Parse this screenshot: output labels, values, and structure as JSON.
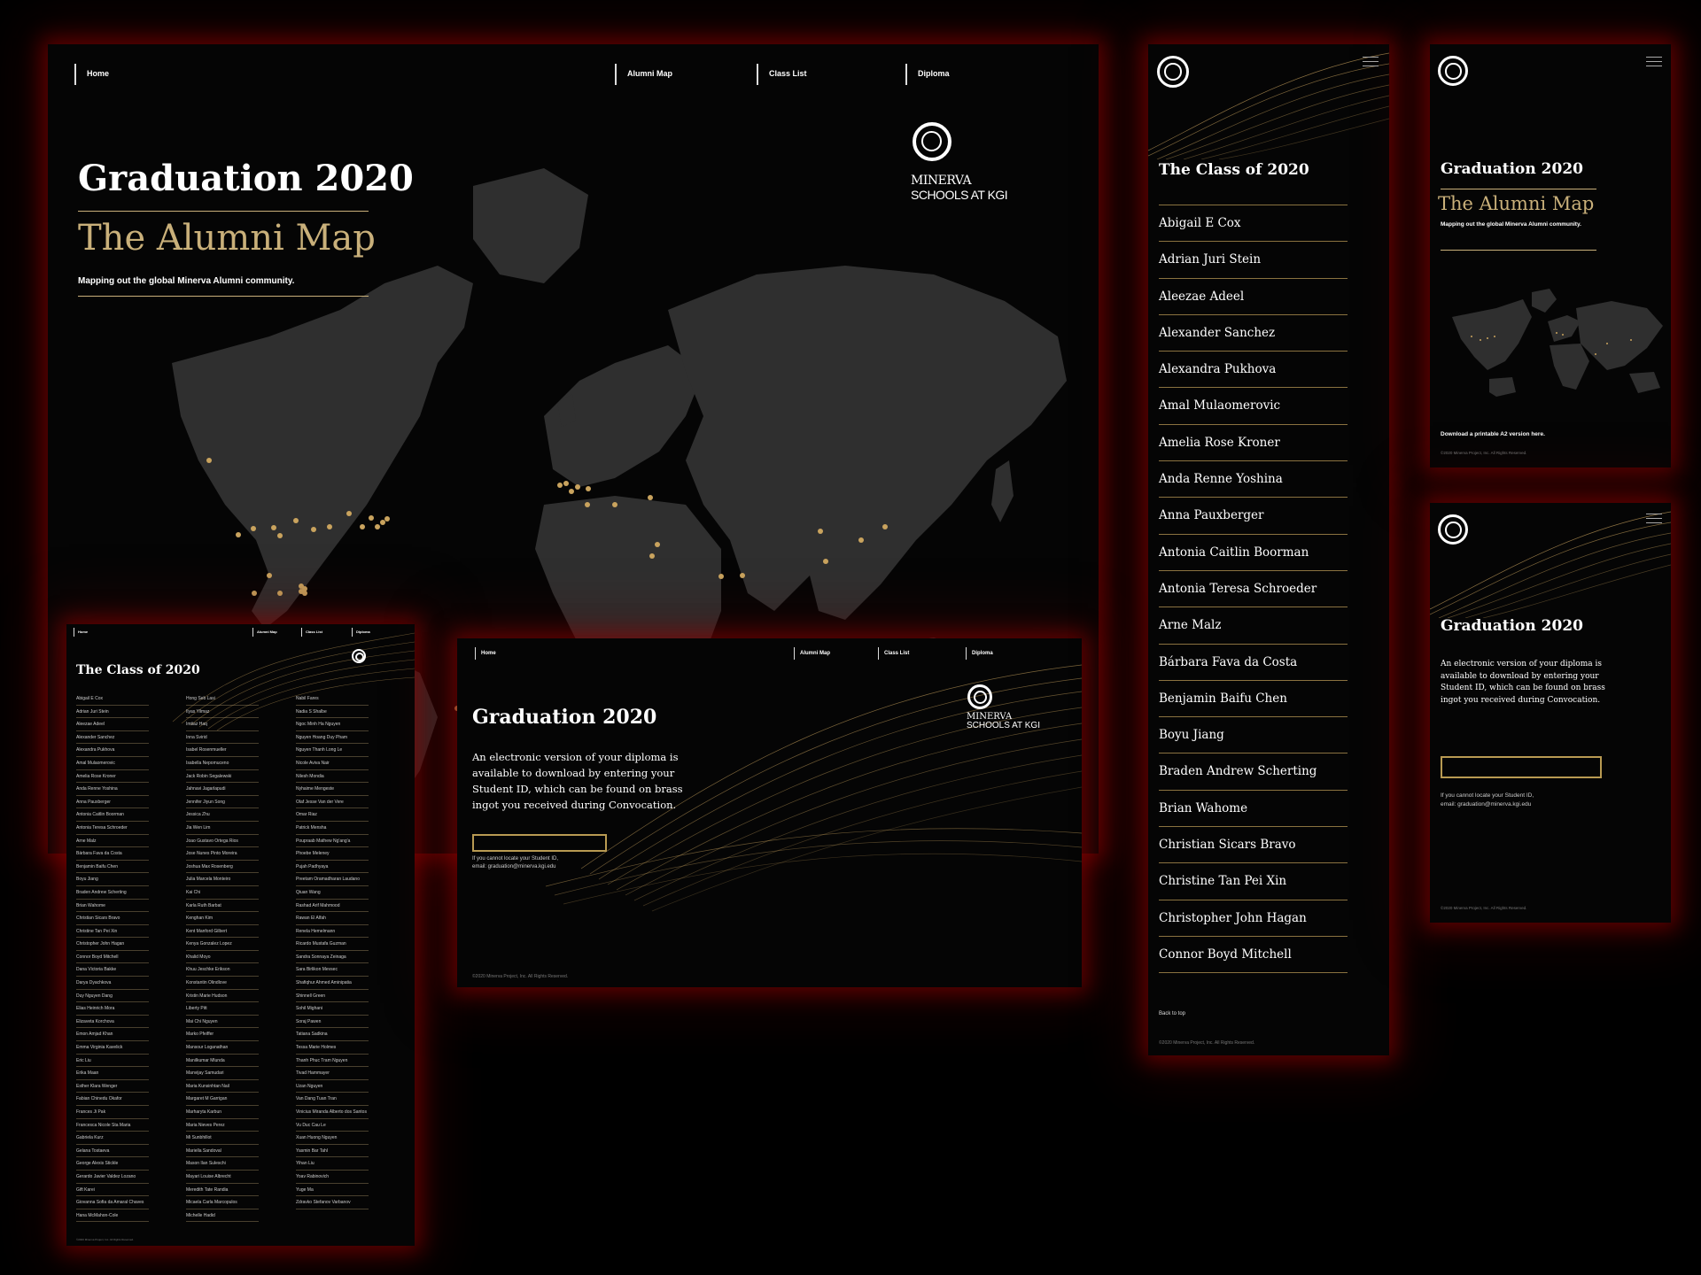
{
  "nav": {
    "home": "Home",
    "alumni_map": "Alumni Map",
    "class_list": "Class List",
    "diploma": "Diploma"
  },
  "brand": {
    "line1": "MINERVA",
    "line2": "SCHOOLS AT KGI",
    "trademark": "®"
  },
  "map_page": {
    "title": "Graduation 2020",
    "subtitle": "The Alumni Map",
    "tagline": "Mapping out the global Minerva Alumni community.",
    "download": "Download a printable A2 version here.",
    "copyright": "©2020 Minerva Project, Inc. All Rights Reserved."
  },
  "diploma_page": {
    "title": "Graduation 2020",
    "body": "An electronic version of your diploma is available to download by entering your Student ID, which can be found on brass ingot you received during Convocation.",
    "help_line1": "If you cannot locate your Student ID,",
    "help_line2": "email: graduation@minerva.kgi.edu",
    "input_value": "",
    "copyright": "©2020 Minerva Project, Inc. All Rights Reserved."
  },
  "class_page": {
    "title": "The Class of 2020",
    "back_to_top": "Back to top",
    "copyright": "©2020 Minerva Project, Inc. All Rights Reserved.",
    "mobile_names": [
      "Abigail E Cox",
      "Adrian Juri Stein",
      "Aleezae Adeel",
      "Alexander Sanchez",
      "Alexandra Pukhova",
      "Amal Mulaomerovic",
      "Amelia Rose Kroner",
      "Anda Renne Yoshina",
      "Anna Pauxberger",
      "Antonia Caitlin Boorman",
      "Antonia Teresa Schroeder",
      "Arne Malz",
      "Bárbara Fava da Costa",
      "Benjamin Baifu Chen",
      "Boyu Jiang",
      "Braden Andrew Scherting",
      "Brian Wahome",
      "Christian Sicars Bravo",
      "Christine Tan Pei Xin",
      "Christopher John Hagan",
      "Connor Boyd Mitchell"
    ],
    "column1": [
      "Abigail E Cox",
      "Adrian Juri Stein",
      "Aleezae Adeel",
      "Alexander Sanchez",
      "Alexandra Pukhova",
      "Amal Mulaomerovic",
      "Amelia Rose Kroner",
      "Anda Renne Yoshina",
      "Anna Pauxberger",
      "Antonia Caitlin Boorman",
      "Antonia Teresa Schroeder",
      "Arne Malz",
      "Bárbara Fava da Costa",
      "Benjamin Baifu Chen",
      "Boyu Jiang",
      "Braden Andrew Scherting",
      "Brian Wahome",
      "Christian Sicars Bravo",
      "Christine Tan Pei Xin",
      "Christopher John Hagan",
      "Connor Boyd Mitchell",
      "Dana Victoria Bakke",
      "Darya Dyachkova",
      "Duy Nguyen Dang",
      "Elias Heinrich Mora",
      "Elizaveta Korchova",
      "Emon Amjad Khan",
      "Emma Virginia Kavelick",
      "Eric Liu",
      "Erika Maan",
      "Esther Klara Wenger",
      "Fabian Chinedu Okafor",
      "Frances Ji Pak",
      "Francesca Nicole Sta Maria",
      "Gabriela Kurz",
      "Gelana Tostaeva",
      "George Alexis Stickle",
      "Gerardo Javier Valdez Lozano",
      "Gift Karei",
      "Giovanna Sofia da Amaral Chaves",
      "Hana McMahon-Cole"
    ],
    "column2": [
      "Hong Seb Lasi",
      "Ilyas Yilmaz",
      "Imtiaz Haq",
      "Inna Svirid",
      "Isabel Rosenmueller",
      "Isabella Nepomuceno",
      "Jack Robin Segalewski",
      "Jahnavi Jagarlapudi",
      "Jennifer Jiyun Song",
      "Jessica Zhu",
      "Jia Wen Lim",
      "Joao Gustavo Ortega Rios",
      "Jose Nunes Pinto Moreira",
      "Joshua Max Rosenberg",
      "Julia Marcela Monteiro",
      "Kai Chi",
      "Karla Ruth Barbat",
      "Kenghan Kim",
      "Kent Manford Gilbert",
      "Kenya Gonzalez Lopez",
      "Khalid Moyo",
      "Khuu Jeschke Erikson",
      "Konstantin Olindlove",
      "Kristin Marie Hudson",
      "Liberty Pitt",
      "Mai Chi Nguyen",
      "Marko Pfeiffer",
      "Mansour Loganathan",
      "Manilkumar Mlunda",
      "Manvijay Samudari",
      "Maria Kunsinhtan Nail",
      "Margaret M Garrigan",
      "Marharyta Karbun",
      "Maria Nieves Perez",
      "Mi Sunbhillot",
      "Mariella Sandoval",
      "Mason Ilan Suleschi",
      "Mayari Louise Albrecht",
      "Meredith Tate Randia",
      "Micaela Carla Marcopulos",
      "Michelle Hadid"
    ],
    "column3": [
      "Nabil Fares",
      "Nadia S Shalbe",
      "Ngoc Minh Ha Nguyen",
      "Nguyen Hoang Duy Pham",
      "Nguyen Thanh Long Le",
      "Nicole Aviva Nair",
      "Nilesh Mondia",
      "Nyhaime Mengeste",
      "Olaf Jesse Van der Vere",
      "Omar Riaz",
      "Patrick Mensha",
      "Poupraab Mathew Ng'ang'a",
      "Phoebe Meleney",
      "Pujah Padhyaya",
      "Preetam Oramadharan Laudano",
      "Qiuan Wang",
      "Rashad Arif Mahmood",
      "Rawan El Alfah",
      "Renela Hemelmann",
      "Ricardo Mustafa Guzman",
      "Sandra Sonnaya Zeinaga",
      "Sara Birlikon Mevsec",
      "Shafiqhur Ahmed Aminipatia",
      "Shinnell Green",
      "Sohil Mighani",
      "Soraj Pawen",
      "Tatiana Sadkina",
      "Tessa Marie Holmes",
      "Thanh Phuc Tram Nguyen",
      "Tivad Hammayer",
      "Uzan Nguyen",
      "Van Dang Tuan Tran",
      "Vinicius Miranda Alberto dos Santos",
      "Vu Duc Cau Le",
      "Xuan Huong Nguyen",
      "Yasmin Bar Tahl",
      "Yihan Liu",
      "Yoav Rabinovich",
      "Yuge Ma",
      "Zdravko Stefanov Varbanov"
    ]
  },
  "colors": {
    "accent_gold": "#c9b07a",
    "background": "#050505",
    "glow": "#8b0000",
    "map_land": "#2f2f2f"
  },
  "icons": [
    "minerva-logo-icon",
    "hamburger-menu-icon"
  ]
}
